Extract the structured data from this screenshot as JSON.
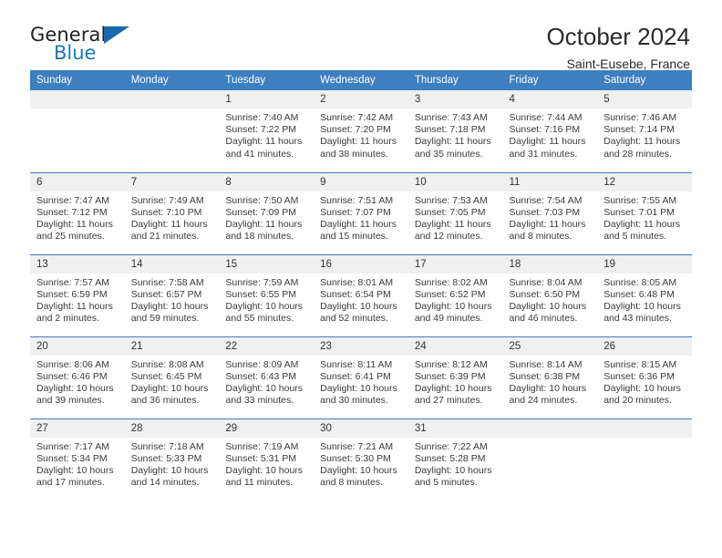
{
  "brand": {
    "name_top": "General",
    "name_bottom": "Blue",
    "flag_icon": "blue-triangle-flag"
  },
  "header": {
    "title": "October 2024",
    "location": "Saint-Eusebe, France"
  },
  "colors": {
    "header_blue": "#3d7fbf",
    "brand_blue": "#1878c0",
    "daynum_band": "#f0f0f0"
  },
  "weekday_headers": [
    "Sunday",
    "Monday",
    "Tuesday",
    "Wednesday",
    "Thursday",
    "Friday",
    "Saturday"
  ],
  "weeks": [
    [
      {
        "day": "",
        "blank": true
      },
      {
        "day": "",
        "blank": true
      },
      {
        "day": "1",
        "sunrise": "Sunrise: 7:40 AM",
        "sunset": "Sunset: 7:22 PM",
        "daylight_1": "Daylight: 11 hours",
        "daylight_2": "and 41 minutes."
      },
      {
        "day": "2",
        "sunrise": "Sunrise: 7:42 AM",
        "sunset": "Sunset: 7:20 PM",
        "daylight_1": "Daylight: 11 hours",
        "daylight_2": "and 38 minutes."
      },
      {
        "day": "3",
        "sunrise": "Sunrise: 7:43 AM",
        "sunset": "Sunset: 7:18 PM",
        "daylight_1": "Daylight: 11 hours",
        "daylight_2": "and 35 minutes."
      },
      {
        "day": "4",
        "sunrise": "Sunrise: 7:44 AM",
        "sunset": "Sunset: 7:16 PM",
        "daylight_1": "Daylight: 11 hours",
        "daylight_2": "and 31 minutes."
      },
      {
        "day": "5",
        "sunrise": "Sunrise: 7:46 AM",
        "sunset": "Sunset: 7:14 PM",
        "daylight_1": "Daylight: 11 hours",
        "daylight_2": "and 28 minutes."
      }
    ],
    [
      {
        "day": "6",
        "sunrise": "Sunrise: 7:47 AM",
        "sunset": "Sunset: 7:12 PM",
        "daylight_1": "Daylight: 11 hours",
        "daylight_2": "and 25 minutes."
      },
      {
        "day": "7",
        "sunrise": "Sunrise: 7:49 AM",
        "sunset": "Sunset: 7:10 PM",
        "daylight_1": "Daylight: 11 hours",
        "daylight_2": "and 21 minutes."
      },
      {
        "day": "8",
        "sunrise": "Sunrise: 7:50 AM",
        "sunset": "Sunset: 7:09 PM",
        "daylight_1": "Daylight: 11 hours",
        "daylight_2": "and 18 minutes."
      },
      {
        "day": "9",
        "sunrise": "Sunrise: 7:51 AM",
        "sunset": "Sunset: 7:07 PM",
        "daylight_1": "Daylight: 11 hours",
        "daylight_2": "and 15 minutes."
      },
      {
        "day": "10",
        "sunrise": "Sunrise: 7:53 AM",
        "sunset": "Sunset: 7:05 PM",
        "daylight_1": "Daylight: 11 hours",
        "daylight_2": "and 12 minutes."
      },
      {
        "day": "11",
        "sunrise": "Sunrise: 7:54 AM",
        "sunset": "Sunset: 7:03 PM",
        "daylight_1": "Daylight: 11 hours",
        "daylight_2": "and 8 minutes."
      },
      {
        "day": "12",
        "sunrise": "Sunrise: 7:55 AM",
        "sunset": "Sunset: 7:01 PM",
        "daylight_1": "Daylight: 11 hours",
        "daylight_2": "and 5 minutes."
      }
    ],
    [
      {
        "day": "13",
        "sunrise": "Sunrise: 7:57 AM",
        "sunset": "Sunset: 6:59 PM",
        "daylight_1": "Daylight: 11 hours",
        "daylight_2": "and 2 minutes."
      },
      {
        "day": "14",
        "sunrise": "Sunrise: 7:58 AM",
        "sunset": "Sunset: 6:57 PM",
        "daylight_1": "Daylight: 10 hours",
        "daylight_2": "and 59 minutes."
      },
      {
        "day": "15",
        "sunrise": "Sunrise: 7:59 AM",
        "sunset": "Sunset: 6:55 PM",
        "daylight_1": "Daylight: 10 hours",
        "daylight_2": "and 55 minutes."
      },
      {
        "day": "16",
        "sunrise": "Sunrise: 8:01 AM",
        "sunset": "Sunset: 6:54 PM",
        "daylight_1": "Daylight: 10 hours",
        "daylight_2": "and 52 minutes."
      },
      {
        "day": "17",
        "sunrise": "Sunrise: 8:02 AM",
        "sunset": "Sunset: 6:52 PM",
        "daylight_1": "Daylight: 10 hours",
        "daylight_2": "and 49 minutes."
      },
      {
        "day": "18",
        "sunrise": "Sunrise: 8:04 AM",
        "sunset": "Sunset: 6:50 PM",
        "daylight_1": "Daylight: 10 hours",
        "daylight_2": "and 46 minutes."
      },
      {
        "day": "19",
        "sunrise": "Sunrise: 8:05 AM",
        "sunset": "Sunset: 6:48 PM",
        "daylight_1": "Daylight: 10 hours",
        "daylight_2": "and 43 minutes."
      }
    ],
    [
      {
        "day": "20",
        "sunrise": "Sunrise: 8:06 AM",
        "sunset": "Sunset: 6:46 PM",
        "daylight_1": "Daylight: 10 hours",
        "daylight_2": "and 39 minutes."
      },
      {
        "day": "21",
        "sunrise": "Sunrise: 8:08 AM",
        "sunset": "Sunset: 6:45 PM",
        "daylight_1": "Daylight: 10 hours",
        "daylight_2": "and 36 minutes."
      },
      {
        "day": "22",
        "sunrise": "Sunrise: 8:09 AM",
        "sunset": "Sunset: 6:43 PM",
        "daylight_1": "Daylight: 10 hours",
        "daylight_2": "and 33 minutes."
      },
      {
        "day": "23",
        "sunrise": "Sunrise: 8:11 AM",
        "sunset": "Sunset: 6:41 PM",
        "daylight_1": "Daylight: 10 hours",
        "daylight_2": "and 30 minutes."
      },
      {
        "day": "24",
        "sunrise": "Sunrise: 8:12 AM",
        "sunset": "Sunset: 6:39 PM",
        "daylight_1": "Daylight: 10 hours",
        "daylight_2": "and 27 minutes."
      },
      {
        "day": "25",
        "sunrise": "Sunrise: 8:14 AM",
        "sunset": "Sunset: 6:38 PM",
        "daylight_1": "Daylight: 10 hours",
        "daylight_2": "and 24 minutes."
      },
      {
        "day": "26",
        "sunrise": "Sunrise: 8:15 AM",
        "sunset": "Sunset: 6:36 PM",
        "daylight_1": "Daylight: 10 hours",
        "daylight_2": "and 20 minutes."
      }
    ],
    [
      {
        "day": "27",
        "sunrise": "Sunrise: 7:17 AM",
        "sunset": "Sunset: 5:34 PM",
        "daylight_1": "Daylight: 10 hours",
        "daylight_2": "and 17 minutes."
      },
      {
        "day": "28",
        "sunrise": "Sunrise: 7:18 AM",
        "sunset": "Sunset: 5:33 PM",
        "daylight_1": "Daylight: 10 hours",
        "daylight_2": "and 14 minutes."
      },
      {
        "day": "29",
        "sunrise": "Sunrise: 7:19 AM",
        "sunset": "Sunset: 5:31 PM",
        "daylight_1": "Daylight: 10 hours",
        "daylight_2": "and 11 minutes."
      },
      {
        "day": "30",
        "sunrise": "Sunrise: 7:21 AM",
        "sunset": "Sunset: 5:30 PM",
        "daylight_1": "Daylight: 10 hours",
        "daylight_2": "and 8 minutes."
      },
      {
        "day": "31",
        "sunrise": "Sunrise: 7:22 AM",
        "sunset": "Sunset: 5:28 PM",
        "daylight_1": "Daylight: 10 hours",
        "daylight_2": "and 5 minutes."
      },
      {
        "day": "",
        "blank": true
      },
      {
        "day": "",
        "blank": true
      }
    ]
  ]
}
